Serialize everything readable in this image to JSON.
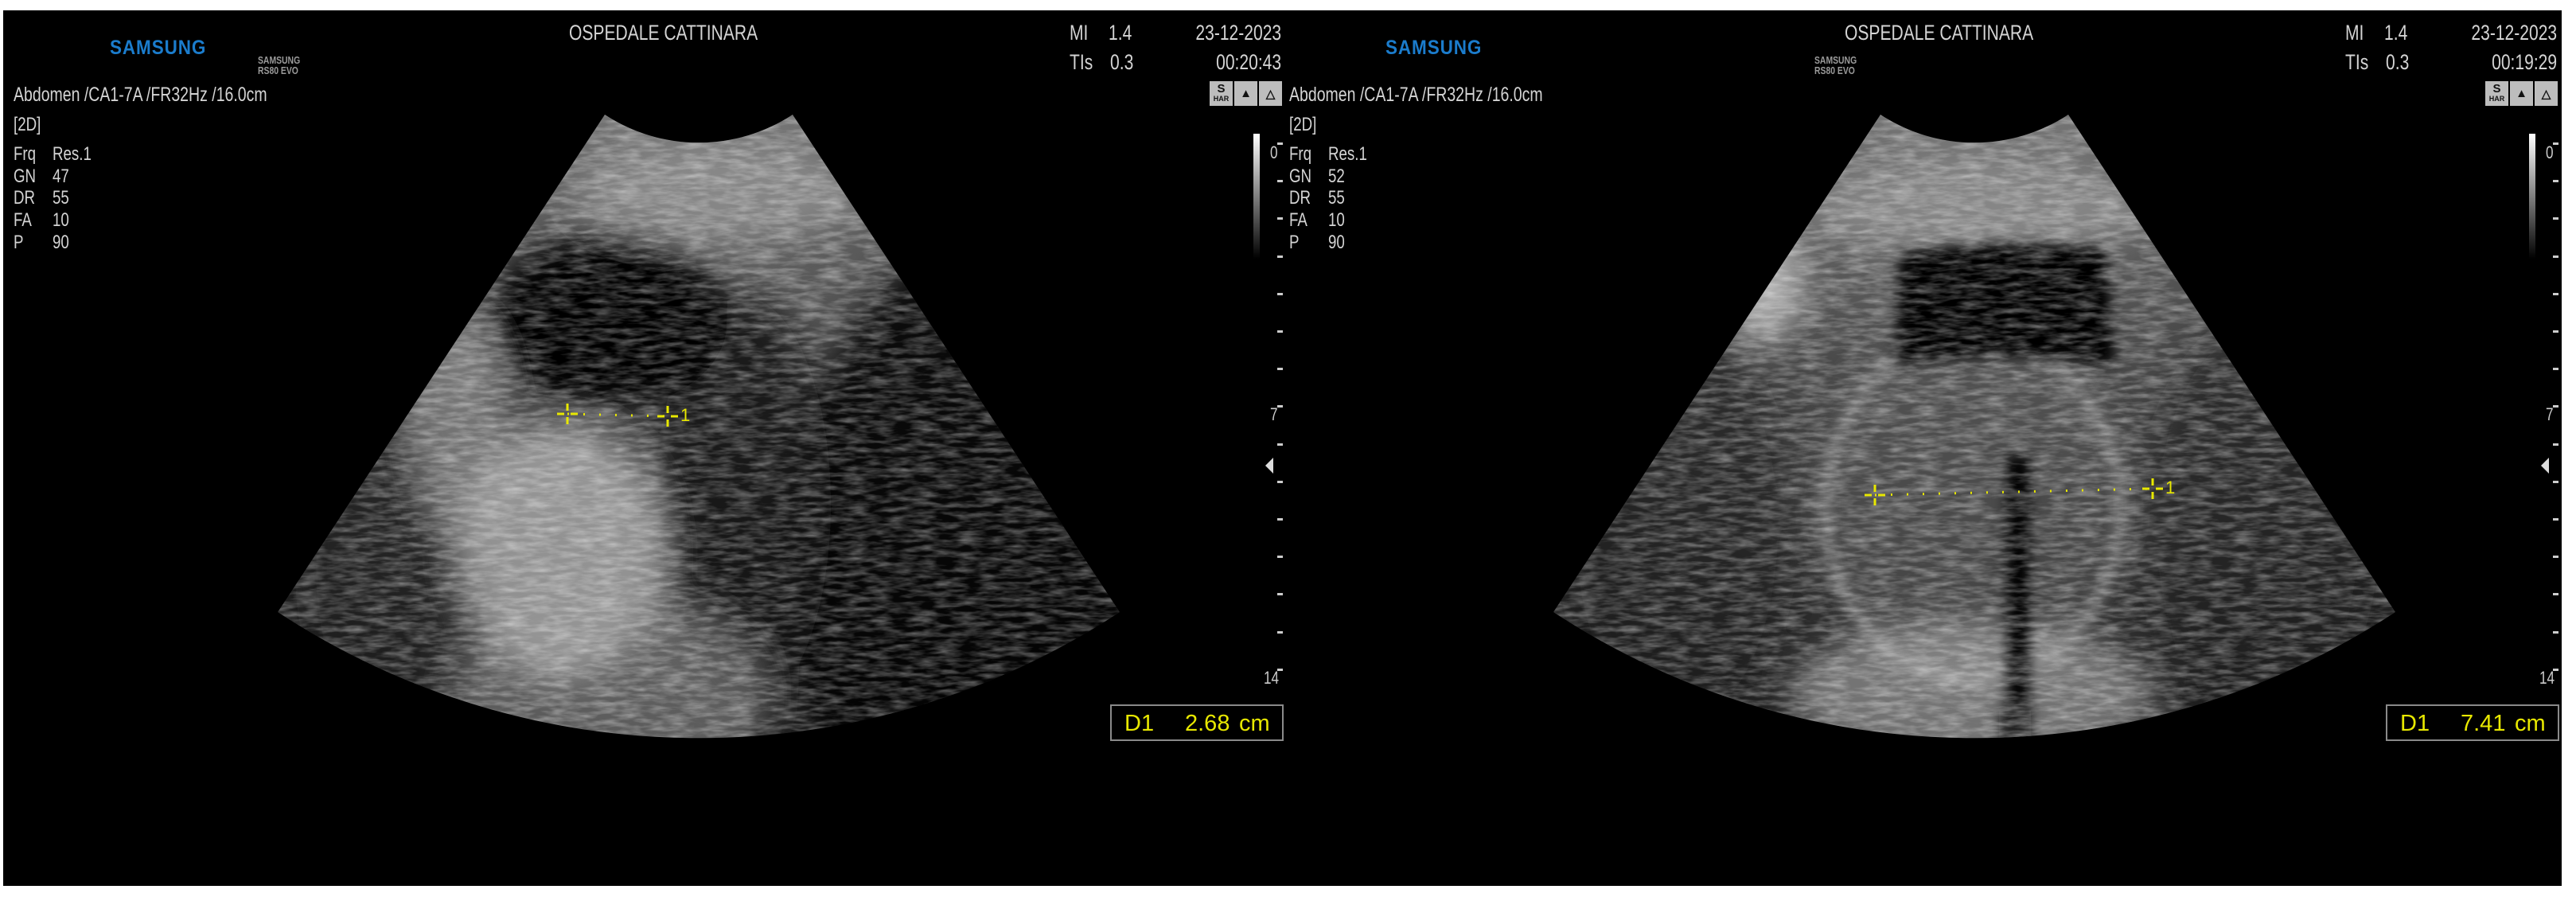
{
  "brand_color": "#1b7ccc",
  "measure_color": "#e8e800",
  "panels": [
    {
      "logo": "SAMSUNG",
      "hospital": "OSPEDALE CATTINARA",
      "mi_label": "MI",
      "mi_value": "1.4",
      "tis_label": "TIs",
      "tis_value": "0.3",
      "date": "23-12-2023",
      "time": "00:20:43",
      "exam_info": "Abdomen /CA1-7A /FR32Hz /16.0cm",
      "mode": "[2D]",
      "params": [
        {
          "label": "Frq",
          "value": "Res.1"
        },
        {
          "label": "GN",
          "value": "47"
        },
        {
          "label": "DR",
          "value": "55"
        },
        {
          "label": "FA",
          "value": "10"
        },
        {
          "label": "P",
          "value": "90"
        }
      ],
      "watermark": [
        "SAMSUNG",
        "RS80 EVO"
      ],
      "icons": {
        "s": "S",
        "har": "HAR"
      },
      "depth_scale": {
        "top": "0",
        "mid": "7",
        "bottom": "14"
      },
      "caliper_label": "1",
      "measurement": {
        "name": "D1",
        "value": "2.68",
        "unit": "cm"
      }
    },
    {
      "logo": "SAMSUNG",
      "hospital": "OSPEDALE CATTINARA",
      "mi_label": "MI",
      "mi_value": "1.4",
      "tis_label": "TIs",
      "tis_value": "0.3",
      "date": "23-12-2023",
      "time": "00:19:29",
      "exam_info": "Abdomen /CA1-7A /FR32Hz /16.0cm",
      "mode": "[2D]",
      "params": [
        {
          "label": "Frq",
          "value": "Res.1"
        },
        {
          "label": "GN",
          "value": "52"
        },
        {
          "label": "DR",
          "value": "55"
        },
        {
          "label": "FA",
          "value": "10"
        },
        {
          "label": "P",
          "value": "90"
        }
      ],
      "watermark": [
        "SAMSUNG",
        "RS80 EVO"
      ],
      "icons": {
        "s": "S",
        "har": "HAR"
      },
      "depth_scale": {
        "top": "0",
        "mid": "7",
        "bottom": "14"
      },
      "caliper_label": "1",
      "measurement": {
        "name": "D1",
        "value": "7.41",
        "unit": "cm"
      }
    }
  ]
}
